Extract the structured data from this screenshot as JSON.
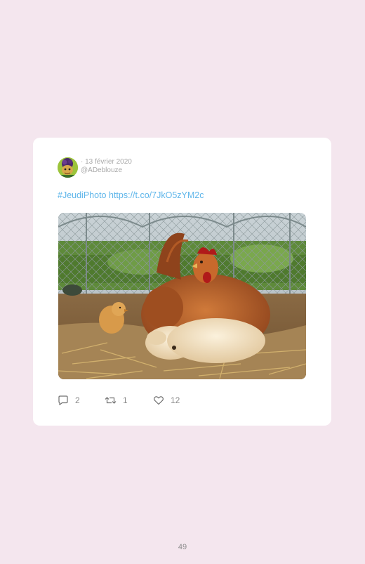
{
  "tweet": {
    "date": "· 13 février 2020",
    "handle": "@ADeblouze",
    "hashtag": "#JeudiPhoto",
    "link": "https://t.co/7JkO5zYM2c"
  },
  "actions": {
    "replies": {
      "icon": "reply-icon",
      "count": "2"
    },
    "retweets": {
      "icon": "retweet-icon",
      "count": "1"
    },
    "likes": {
      "icon": "heart-icon",
      "count": "12"
    }
  },
  "footer": {
    "page_number": "49"
  },
  "colors": {
    "background": "#f4e6ee",
    "card": "#ffffff",
    "link": "#5fb6ea",
    "muted": "#a8a8a8"
  }
}
